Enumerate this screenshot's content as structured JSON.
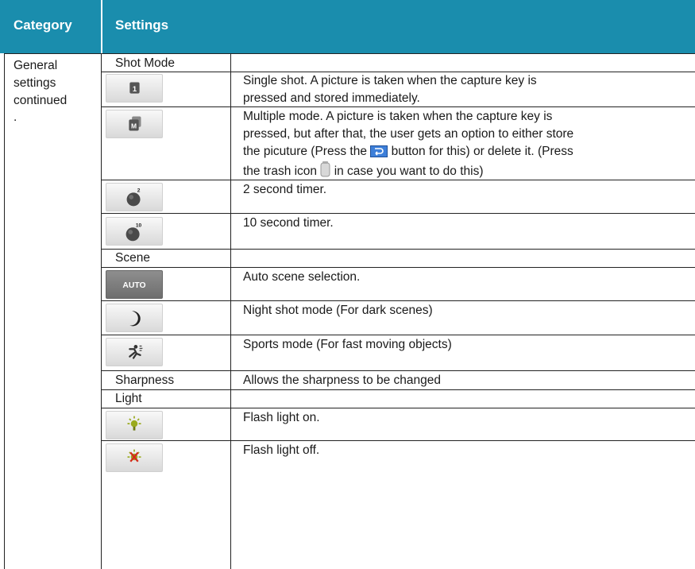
{
  "header": {
    "category": "Category",
    "settings": "Settings"
  },
  "category_text": [
    "General",
    "settings",
    "continued",
    "."
  ],
  "rows": {
    "shot_mode": "Shot Mode",
    "single_shot_1": "Single shot. A picture is taken when the capture key is",
    "single_shot_2": "pressed and stored immediately.",
    "multi_1": "Multiple mode. A picture is taken when the capture key is",
    "multi_2": "pressed, but after that, the user gets an option to either store",
    "multi_3a": "the picuture (Press the",
    "multi_3b": "button for this) or delete it. (Press",
    "multi_4a": "the trash icon",
    "multi_4b": "in case you want to do this)",
    "timer2": "2 second timer.",
    "timer10": "10 second timer.",
    "scene": "Scene",
    "auto": "Auto scene selection.",
    "night": "Night shot mode (For dark scenes)",
    "sports": "Sports mode (For fast moving objects)",
    "sharpness": "Sharpness",
    "sharpness_desc": "Allows the sharpness to be changed",
    "light": "Light",
    "flash_on": "Flash light on.",
    "flash_off": "Flash light off."
  },
  "icons": {
    "single": "single-shot-icon",
    "multiple": "multiple-shot-icon",
    "timer2": "timer-2s-icon",
    "timer10": "timer-10s-icon",
    "auto": "auto-scene-icon",
    "night": "night-mode-icon",
    "sports": "sports-mode-icon",
    "flash_on": "flash-on-icon",
    "flash_off": "flash-off-icon",
    "store": "store-button-icon",
    "trash": "trash-icon",
    "auto_label": "AUTO",
    "single_label": "1",
    "multiple_label": "M",
    "timer2_label": "2",
    "timer10_label": "10"
  },
  "colors": {
    "header_bg": "#1a8dad",
    "header_text": "#ffffff",
    "rule": "#222222"
  }
}
